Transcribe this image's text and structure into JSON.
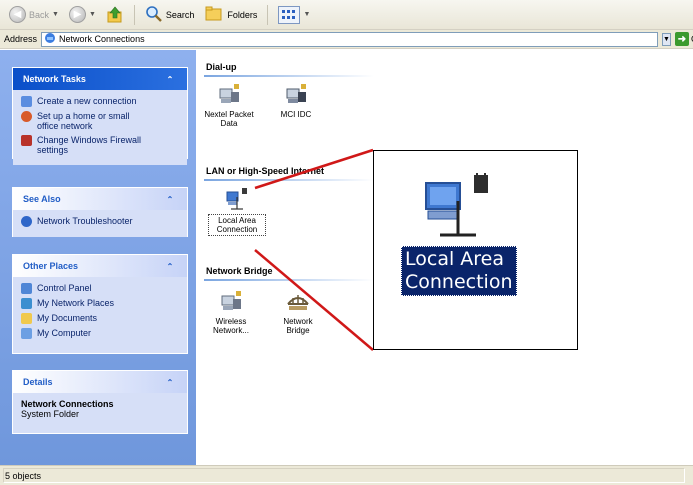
{
  "toolbar": {
    "back_label": "Back",
    "search_label": "Search",
    "folders_label": "Folders"
  },
  "address": {
    "label": "Address",
    "value": "Network Connections",
    "go_label": "Go"
  },
  "sidebar": {
    "network_tasks": {
      "title": "Network Tasks",
      "items": [
        {
          "label": "Create a new connection",
          "icon": "new-connection-icon"
        },
        {
          "label": "Set up a home or small office network",
          "icon": "home-network-icon"
        },
        {
          "label": "Change Windows Firewall settings",
          "icon": "firewall-icon"
        }
      ]
    },
    "see_also": {
      "title": "See Also",
      "items": [
        {
          "label": "Network Troubleshooter",
          "icon": "troubleshooter-icon"
        }
      ]
    },
    "other_places": {
      "title": "Other Places",
      "items": [
        {
          "label": "Control Panel",
          "icon": "control-panel-icon"
        },
        {
          "label": "My Network Places",
          "icon": "network-places-icon"
        },
        {
          "label": "My Documents",
          "icon": "documents-folder-icon"
        },
        {
          "label": "My Computer",
          "icon": "computer-icon"
        }
      ]
    },
    "details": {
      "title": "Details",
      "name": "Network Connections",
      "type": "System Folder"
    }
  },
  "groups": {
    "dialup": {
      "title": "Dial-up",
      "items": [
        {
          "label_line1": "Nextel Packet",
          "label_line2": "Data"
        },
        {
          "label_line1": "MCI IDC",
          "label_line2": ""
        }
      ]
    },
    "lan": {
      "title": "LAN or High-Speed Internet",
      "items": [
        {
          "label_line1": "Local Area",
          "label_line2": "Connection"
        }
      ]
    },
    "bridge": {
      "title": "Network Bridge",
      "items": [
        {
          "label_line1": "Wireless",
          "label_line2": "Network..."
        },
        {
          "label_line1": "Network",
          "label_line2": "Bridge"
        }
      ]
    }
  },
  "callout": {
    "label_line1": "Local Area",
    "label_line2": "Connection"
  },
  "status": {
    "text": "5 objects"
  },
  "colors": {
    "taskpane_bg": "#7ca2e5",
    "panel_header_blue": "#0a4fc9",
    "selection": "#0a246a",
    "callout_line": "#d01818"
  }
}
